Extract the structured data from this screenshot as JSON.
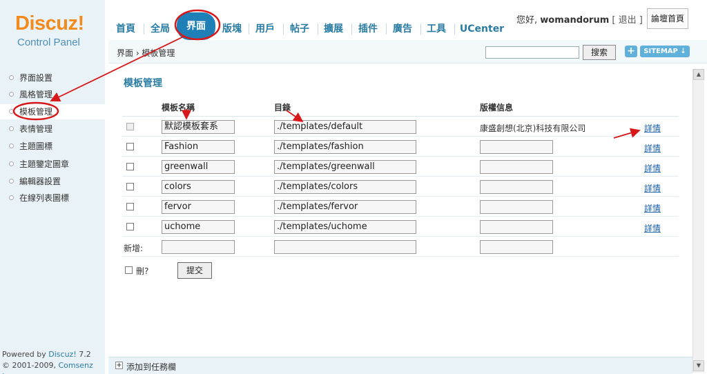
{
  "logo": {
    "brand": "Discuz!",
    "subtitle": "Control Panel"
  },
  "topnav": {
    "items": [
      {
        "label": "首頁"
      },
      {
        "label": "全局"
      },
      {
        "label": "界面"
      },
      {
        "label": "版塊"
      },
      {
        "label": "用戶"
      },
      {
        "label": "帖子"
      },
      {
        "label": "擴展"
      },
      {
        "label": "插件"
      },
      {
        "label": "廣告"
      },
      {
        "label": "工具"
      },
      {
        "label": "UCenter"
      }
    ],
    "active": "界面"
  },
  "user": {
    "greeting": "您好,",
    "name": "womandorum",
    "logout": "[ 退出 ]",
    "forum_home": "論壇首頁"
  },
  "subbar": {
    "breadcrumb": "界面 › 模板管理",
    "search_button": "搜索",
    "plus": "+",
    "sitemap": "SITEMAP ↓"
  },
  "sidebar": {
    "items": [
      {
        "label": "界面設置"
      },
      {
        "label": "風格管理"
      },
      {
        "label": "模板管理"
      },
      {
        "label": "表情管理"
      },
      {
        "label": "主題圖標"
      },
      {
        "label": "主題鑒定圖章"
      },
      {
        "label": "編輯器設置"
      },
      {
        "label": "在線列表圖標"
      }
    ],
    "active": "模板管理",
    "powered_line1_a": "Powered by ",
    "powered_line1_b": "Discuz!",
    "powered_line1_c": " 7.2",
    "powered_line2_a": "© 2001-2009, ",
    "powered_line2_b": "Comsenz Inc."
  },
  "main": {
    "title": "模板管理",
    "headers": {
      "name": "模板名稱",
      "dir": "目錄",
      "copyright": "版權信息"
    },
    "rows": [
      {
        "name": "默認模板套系",
        "dir": "./templates/default",
        "copyright": "康盛創想(北京)科技有限公司",
        "detail": "詳情",
        "disabled": true
      },
      {
        "name": "Fashion",
        "dir": "./templates/fashion",
        "copyright": "",
        "detail": "詳情"
      },
      {
        "name": "greenwall",
        "dir": "./templates/greenwall",
        "copyright": "",
        "detail": "詳情"
      },
      {
        "name": "colors",
        "dir": "./templates/colors",
        "copyright": "",
        "detail": "詳情"
      },
      {
        "name": "fervor",
        "dir": "./templates/fervor",
        "copyright": "",
        "detail": "詳情"
      },
      {
        "name": "uchome",
        "dir": "./templates/uchome",
        "copyright": "",
        "detail": "詳情"
      }
    ],
    "new_label": "新增:",
    "delete_label": "刪?",
    "submit": "提交"
  },
  "footer": {
    "plus": "+",
    "label": "添加到任務欄"
  },
  "colors": {
    "accent": "#2b7ca3",
    "nav_active": "#1f80b8",
    "annotation": "#d81818",
    "brand": "#f28a1c"
  }
}
